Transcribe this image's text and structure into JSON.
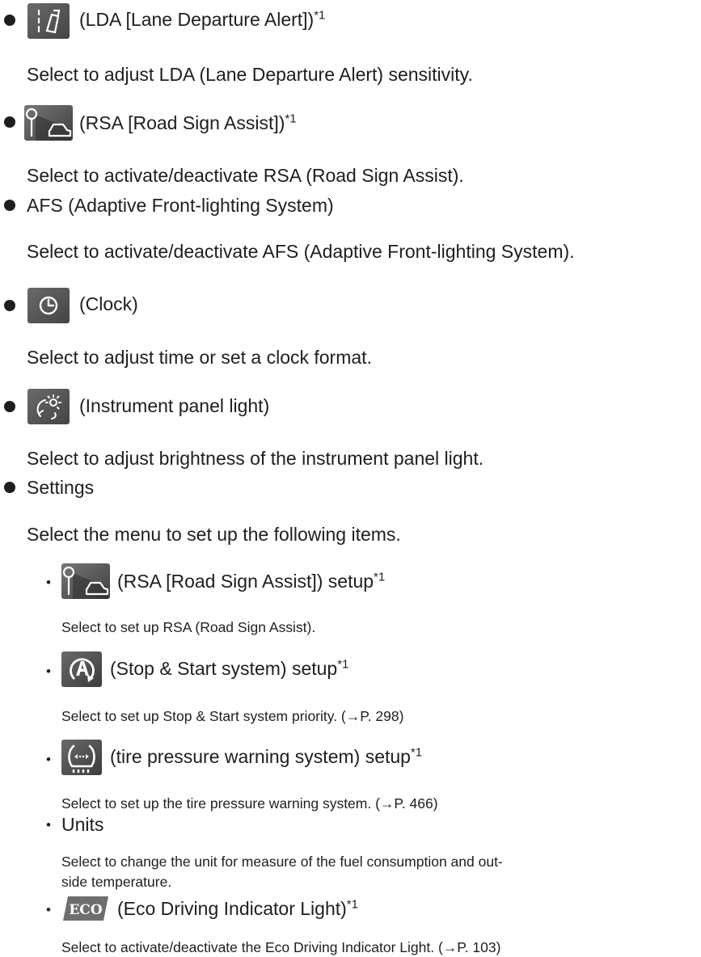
{
  "items": {
    "lda": {
      "label": "(LDA [Lane Departure Alert])",
      "note": "*1",
      "desc": "Select to adjust LDA (Lane Departure Alert) sensitivity."
    },
    "rsa": {
      "label": "(RSA [Road Sign Assist])",
      "note": "*1",
      "desc": "Select to activate/deactivate RSA (Road Sign Assist)."
    },
    "afs": {
      "label": "AFS (Adaptive Front-lighting System)",
      "desc": "Select to activate/deactivate AFS (Adaptive Front-lighting System)."
    },
    "clock": {
      "label": "(Clock)",
      "desc": "Select to adjust time or set a clock format."
    },
    "panel": {
      "label": "(Instrument panel light)",
      "desc": "Select to adjust brightness of the instrument panel light."
    },
    "settings": {
      "label": "Settings",
      "desc": "Select the menu to set up the following items."
    }
  },
  "sub_items": {
    "rsa_setup": {
      "label": "(RSA [Road Sign Assist]) setup",
      "note": "*1",
      "desc": "Select to set up RSA (Road Sign Assist)."
    },
    "stop_start": {
      "label": "(Stop & Start system) setup",
      "note": "*1",
      "desc": "Select to set up Stop & Start system priority. (→P. 298)"
    },
    "tire": {
      "label": "(tire pressure warning system) setup",
      "note": "*1",
      "desc": "Select to set up the tire pressure warning system. (→P. 466)"
    },
    "units": {
      "label": "Units",
      "desc_line1": "Select to change the unit for measure of the fuel consumption and out-",
      "desc_line2": "side temperature."
    },
    "eco": {
      "label": "(Eco Driving Indicator Light)",
      "note": "*1",
      "desc": "Select to activate/deactivate the Eco Driving Indicator Light. (→P. 103)",
      "icon_text": "ECO"
    }
  },
  "bullet_char": "•",
  "icons": {
    "lda": "lane-departure-icon",
    "rsa": "road-sign-assist-icon",
    "clock": "clock-icon",
    "panel": "instrument-panel-light-icon",
    "stop_start": "stop-start-icon",
    "tire": "tire-pressure-icon",
    "eco": "eco-indicator-icon"
  },
  "colors": {
    "text": "#1e1e1e",
    "icon_bg": "#5a5a5a",
    "icon_fg": "#ffffff",
    "eco_bg": "#6e6e6e"
  }
}
